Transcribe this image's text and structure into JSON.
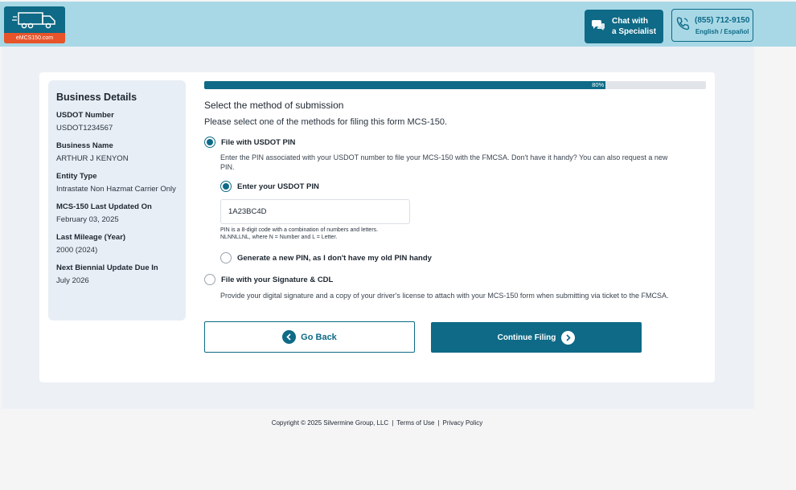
{
  "header": {
    "logo_text": "eMCS150.com",
    "chat_line1": "Chat with",
    "chat_line2": "a Specialist",
    "phone": "(855) 712-9150",
    "language": "English / Español"
  },
  "sidebar": {
    "title": "Business Details",
    "items": [
      {
        "label": "USDOT Number",
        "value": "USDOT1234567"
      },
      {
        "label": "Business Name",
        "value": "ARTHUR J KENYON"
      },
      {
        "label": "Entity Type",
        "value": "Intrastate Non Hazmat Carrier Only"
      },
      {
        "label": "MCS-150 Last Updated On",
        "value": "February 03, 2025"
      },
      {
        "label": "Last Mileage (Year)",
        "value": "2000 (2024)"
      },
      {
        "label": "Next Biennial Update Due In",
        "value": "July 2026"
      }
    ]
  },
  "progress": {
    "percent_label": "80%",
    "fraction": 0.8
  },
  "main": {
    "title": "Select the method of submission",
    "subtitle": "Please select one of the methods for filing this form MCS-150.",
    "option_pin": {
      "label": "File with USDOT PIN",
      "description": "Enter the PIN associated with your USDOT number to file your MCS-150 with the FMCSA. Don't have it handy? You can also request a new PIN."
    },
    "sub_enter_pin": {
      "label": "Enter your USDOT PIN"
    },
    "pin_value": "1A23BC4D",
    "pin_hint_line1": "PIN is a 8-digit code with a combination of numbers and letters.",
    "pin_hint_line2": "NLNNLLNL, where N = Number and L = Letter.",
    "sub_generate_pin": {
      "label": "Generate a new PIN, as I don't have my old PIN handy"
    },
    "option_signature": {
      "label": "File with your Signature & CDL",
      "description": "Provide your digital signature and a copy of your driver's license to attach with your MCS-150 form when submitting via ticket to the FMCSA."
    },
    "back_label": "Go Back",
    "continue_label": "Continue Filing"
  },
  "footer": {
    "copyright": "Copyright © 2025 Silvermine Group, LLC",
    "terms": "Terms of Use",
    "privacy": "Privacy Policy"
  },
  "colors": {
    "accent": "#0e6a86",
    "header_bg": "#a8d8e6",
    "logo_orange": "#e7542a"
  }
}
